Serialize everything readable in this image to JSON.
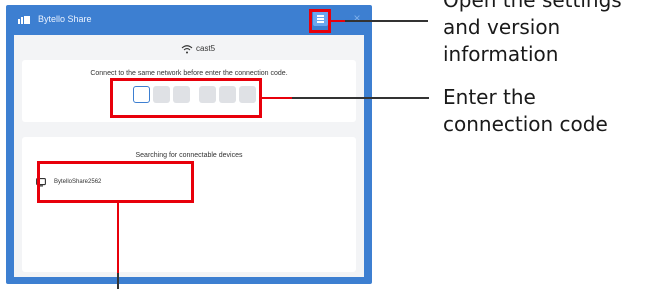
{
  "window": {
    "title": "Bytello Share",
    "close_glyph": "×",
    "menu_icon": "hamburger-menu-icon"
  },
  "network": {
    "icon": "wifi-icon",
    "name": "cast5"
  },
  "connect": {
    "hint": "Connect to the same network before enter the connection code.",
    "code_digits": [
      "",
      "",
      "",
      "",
      "",
      ""
    ]
  },
  "search": {
    "title": "Searching for connectable devices",
    "devices": [
      {
        "icon": "cast-device-icon",
        "name": "BytelloShare2562"
      }
    ]
  },
  "annotations": {
    "settings": [
      "Open the settings",
      "and version",
      "information"
    ],
    "code": [
      "Enter the",
      "connection code"
    ]
  },
  "colors": {
    "window_blue": "#3d7fd1",
    "highlight_red": "#e8000b",
    "panel_gray": "#f3f4f6",
    "code_box_gray": "#dfe1e5"
  }
}
